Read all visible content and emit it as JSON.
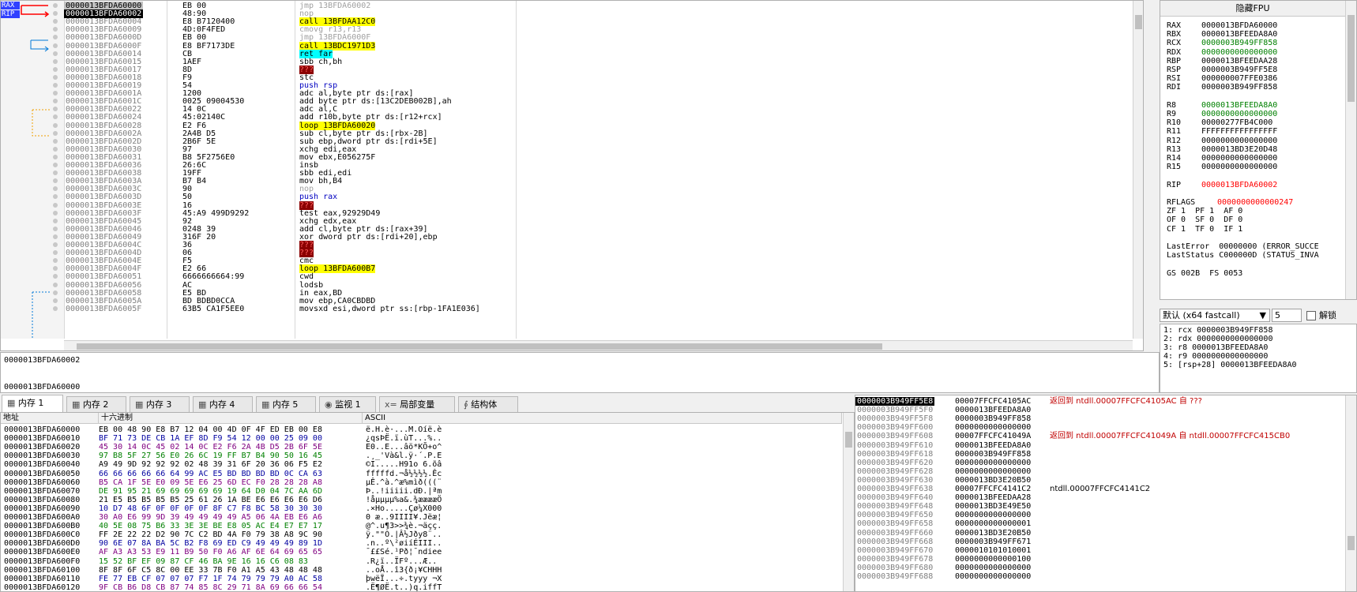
{
  "cpu": {
    "eip_marker": "RAX",
    "rip_marker": "RIP",
    "rows": [
      {
        "addr": "0000013BFDA60000",
        "bytes": "EB 00",
        "asm": "jmp 13BFDA60002",
        "style": "gray",
        "sel": "current"
      },
      {
        "addr": "0000013BFDA60002",
        "bytes": "48:90",
        "asm": "nop",
        "style": "gray",
        "sel": "selected"
      },
      {
        "addr": "0000013BFDA60004",
        "bytes": "E8 B7120400",
        "asm": "call 13BFDAA12C0",
        "style": "call"
      },
      {
        "addr": "0000013BFDA60009",
        "bytes": "4D:0F4FED",
        "asm": "cmovg r13,r13",
        "style": "gray"
      },
      {
        "addr": "0000013BFDA6000D",
        "bytes": "EB 00",
        "asm": "jmp 13BFDA6000F",
        "style": "gray"
      },
      {
        "addr": "0000013BFDA6000F",
        "bytes": "E8 BF7173DE",
        "asm": "call 13BDC1971D3",
        "style": "call"
      },
      {
        "addr": "0000013BFDA60014",
        "bytes": "CB",
        "asm": "ret far",
        "style": "ret"
      },
      {
        "addr": "0000013BFDA60015",
        "bytes": "1AEF",
        "asm": "sbb ch,bh",
        "style": "plain"
      },
      {
        "addr": "0000013BFDA60017",
        "bytes": "8D",
        "asm": "???",
        "style": "bad"
      },
      {
        "addr": "0000013BFDA60018",
        "bytes": "F9",
        "asm": "stc",
        "style": "plain"
      },
      {
        "addr": "0000013BFDA60019",
        "bytes": "54",
        "asm": "push rsp",
        "style": "push"
      },
      {
        "addr": "0000013BFDA6001A",
        "bytes": "1200",
        "asm": "adc al,byte ptr ds:[rax]",
        "style": "plain"
      },
      {
        "addr": "0000013BFDA6001C",
        "bytes": "0025 09004530",
        "asm": "add byte ptr ds:[13C2DEB002B],ah",
        "style": "plain"
      },
      {
        "addr": "0000013BFDA60022",
        "bytes": "14 0C",
        "asm": "adc al,C",
        "style": "plain"
      },
      {
        "addr": "0000013BFDA60024",
        "bytes": "45:02140C",
        "asm": "add r10b,byte ptr ds:[r12+rcx]",
        "style": "plain"
      },
      {
        "addr": "0000013BFDA60028",
        "bytes": "E2 F6",
        "asm": "loop 13BFDA60020",
        "style": "call"
      },
      {
        "addr": "0000013BFDA6002A",
        "bytes": "2A4B D5",
        "asm": "sub cl,byte ptr ds:[rbx-2B]",
        "style": "plain"
      },
      {
        "addr": "0000013BFDA6002D",
        "bytes": "2B6F 5E",
        "asm": "sub ebp,dword ptr ds:[rdi+5E]",
        "style": "plain"
      },
      {
        "addr": "0000013BFDA60030",
        "bytes": "97",
        "asm": "xchg edi,eax",
        "style": "plain"
      },
      {
        "addr": "0000013BFDA60031",
        "bytes": "B8 5F2756E0",
        "asm": "mov ebx,E056275F",
        "style": "plain"
      },
      {
        "addr": "0000013BFDA60036",
        "bytes": "26:6C",
        "asm": "insb",
        "style": "plain"
      },
      {
        "addr": "0000013BFDA60038",
        "bytes": "19FF",
        "asm": "sbb edi,edi",
        "style": "plain"
      },
      {
        "addr": "0000013BFDA6003A",
        "bytes": "B7 B4",
        "asm": "mov bh,B4",
        "style": "plain"
      },
      {
        "addr": "0000013BFDA6003C",
        "bytes": "90",
        "asm": "nop",
        "style": "gray"
      },
      {
        "addr": "0000013BFDA6003D",
        "bytes": "50",
        "asm": "push rax",
        "style": "push"
      },
      {
        "addr": "0000013BFDA6003E",
        "bytes": "16",
        "asm": "???",
        "style": "bad"
      },
      {
        "addr": "0000013BFDA6003F",
        "bytes": "45:A9 499D9292",
        "asm": "test eax,92929D49",
        "style": "plain"
      },
      {
        "addr": "0000013BFDA60045",
        "bytes": "92",
        "asm": "xchg edx,eax",
        "style": "plain"
      },
      {
        "addr": "0000013BFDA60046",
        "bytes": "0248 39",
        "asm": "add cl,byte ptr ds:[rax+39]",
        "style": "plain"
      },
      {
        "addr": "0000013BFDA60049",
        "bytes": "316F 20",
        "asm": "xor dword ptr ds:[rdi+20],ebp",
        "style": "plain"
      },
      {
        "addr": "0000013BFDA6004C",
        "bytes": "36",
        "asm": "???",
        "style": "bad"
      },
      {
        "addr": "0000013BFDA6004D",
        "bytes": "06",
        "asm": "???",
        "style": "bad"
      },
      {
        "addr": "0000013BFDA6004E",
        "bytes": "F5",
        "asm": "cmc",
        "style": "plain"
      },
      {
        "addr": "0000013BFDA6004F",
        "bytes": "E2 66",
        "asm": "loop 13BFDA600B7",
        "style": "call"
      },
      {
        "addr": "0000013BFDA60051",
        "bytes": "6666666664:99",
        "asm": "cwd",
        "style": "plain"
      },
      {
        "addr": "0000013BFDA60056",
        "bytes": "AC",
        "asm": "lodsb",
        "style": "plain"
      },
      {
        "addr": "0000013BFDA60058",
        "bytes": "E5 BD",
        "asm": "in eax,BD",
        "style": "plain"
      },
      {
        "addr": "0000013BFDA6005A",
        "bytes": "BD BDBD0CCA",
        "asm": "mov ebp,CA0CBDBD",
        "style": "plain"
      },
      {
        "addr": "0000013BFDA6005F",
        "bytes": "63B5 CA1F5EE0",
        "asm": "movsxd esi,dword ptr ss:[rbp-1FA1E036]",
        "style": "plain"
      }
    ]
  },
  "info": {
    "line1": "0000013BFDA60002",
    "line2": "0000013BFDA60000"
  },
  "regs": {
    "fpu_button": "隐藏FPU",
    "gp": [
      {
        "n": "RAX",
        "v": "0000013BFDA60000",
        "c": "#000000"
      },
      {
        "n": "RBX",
        "v": "0000013BFEEDA8A0",
        "c": "#000000"
      },
      {
        "n": "RCX",
        "v": "0000003B949FF858",
        "c": "#008000"
      },
      {
        "n": "RDX",
        "v": "0000000000000000",
        "c": "#008000"
      },
      {
        "n": "RBP",
        "v": "0000013BFEEDAA28",
        "c": "#000000"
      },
      {
        "n": "RSP",
        "v": "0000003B949FF5E8",
        "c": "#000000"
      },
      {
        "n": "RSI",
        "v": "000000007FFE0386",
        "c": "#000000"
      },
      {
        "n": "RDI",
        "v": "0000003B949FF858",
        "c": "#000000"
      }
    ],
    "ext": [
      {
        "n": "R8",
        "v": "0000013BFEEDA8A0",
        "c": "#008000"
      },
      {
        "n": "R9",
        "v": "0000000000000000",
        "c": "#008000"
      },
      {
        "n": "R10",
        "v": "00000277FB4C000",
        "c": "#000000"
      },
      {
        "n": "R11",
        "v": "FFFFFFFFFFFFFFFF",
        "c": "#000000"
      },
      {
        "n": "R12",
        "v": "0000000000000000",
        "c": "#000000"
      },
      {
        "n": "R13",
        "v": "0000013BD3E20D48",
        "c": "#000000"
      },
      {
        "n": "R14",
        "v": "0000000000000000",
        "c": "#000000"
      },
      {
        "n": "R15",
        "v": "0000000000000000",
        "c": "#000000"
      }
    ],
    "rip": {
      "n": "RIP",
      "v": "0000013BFDA60002"
    },
    "rflags": {
      "n": "RFLAGS",
      "v": "0000000000000247"
    },
    "flags": [
      "ZF 1  PF 1  AF 0",
      "OF 0  SF 0  DF 0",
      "CF 1  TF 0  IF 1"
    ],
    "lasterror": "LastError  00000000 (ERROR_SUCCE",
    "laststatus": "LastStatus C000000D (STATUS_INVA",
    "segs": "GS 002B  FS 0053"
  },
  "conv": {
    "selected": "默认 (x64 fastcall)",
    "count": "5",
    "unlock_label": "解锁"
  },
  "args": [
    "1: rcx 0000003B949FF858",
    "2: rdx 0000000000000000",
    "3: r8 0000013BFEEDA8A0",
    "4: r9 0000000000000000",
    "5: [rsp+28] 0000013BFEEDA8A0"
  ],
  "tabs": [
    {
      "label": "内存 1",
      "icon": "memory-icon"
    },
    {
      "label": "内存 2",
      "icon": "memory-icon"
    },
    {
      "label": "内存 3",
      "icon": "memory-icon"
    },
    {
      "label": "内存 4",
      "icon": "memory-icon"
    },
    {
      "label": "内存 5",
      "icon": "memory-icon"
    },
    {
      "label": "监视 1",
      "icon": "watch-icon"
    },
    {
      "label": "局部变量",
      "icon": "locals-icon"
    },
    {
      "label": "结构体",
      "icon": "struct-icon"
    }
  ],
  "dump": {
    "headers": {
      "addr": "地址",
      "hex": "十六进制",
      "ascii": "ASCII"
    },
    "rows": [
      {
        "a": "0000013BFDA60000",
        "h": "EB 00 48 90 E8 B7 12 04 00 4D 0F 4F ED EB 00 E8",
        "s": "ë.H.è·...M.Oíë.è"
      },
      {
        "a": "0000013BFDA60010",
        "h": "BF 71 73 DE CB 1A EF 8D F9 54 12 00 00 25 09 00",
        "s": "¿qsÞË.ï.ùT...%.."
      },
      {
        "a": "0000013BFDA60020",
        "h": "45 30 14 0C 45 02 14 0C E2 F6 2A 4B D5 2B 6F 5E",
        "s": "E0..E...âö*KÕ+o^"
      },
      {
        "a": "0000013BFDA60030",
        "h": "97 B8 5F 27 56 E0 26 6C 19 FF B7 B4 90 50 16 45",
        "s": ".¸_'Và&l.ÿ·´.P.E"
      },
      {
        "a": "0000013BFDA60040",
        "h": "A9 49 9D 92 92 92 02 48 39 31 6F 20 36 06 F5 E2",
        "s": "©I.....H91o 6.õâ"
      },
      {
        "a": "0000013BFDA60050",
        "h": "66 66 66 66 66 64 99 AC E5 BD BD BD BD 0C CA 63",
        "s": "fffffd.¬å½½½½.Êc"
      },
      {
        "a": "0000013BFDA60060",
        "h": "B5 CA 1F 5E E0 09 5E E6 25 6D EC F0 28 28 28 A8",
        "s": "µÊ.^à.^æ%mìð(((¨"
      },
      {
        "a": "0000013BFDA60070",
        "h": "DE 91 95 21 69 69 69 69 69 19 64 D0 04 7C AA 6D",
        "s": "Þ..!iiiii.dÐ.|ªm"
      },
      {
        "a": "0000013BFDA60080",
        "h": "21 E5 B5 B5 B5 B5 25 61 26 1A BE E6 E6 E6 E6 D6",
        "s": "!åµµµµ%a&.¾ææææÖ"
      },
      {
        "a": "0000013BFDA60090",
        "h": "10 D7 48 6F 0F 0F 0F 0F 8F C7 F8 BC 58 30 30 30",
        "s": ".×Ho.....Çø¼X000"
      },
      {
        "a": "0000013BFDA600A0",
        "h": "30 A0 E6 99 9D 39 49 49 49 49 A5 06 4A EB E6 A6",
        "s": "0 æ..9IIII¥.Jëæ¦"
      },
      {
        "a": "0000013BFDA600B0",
        "h": "40 5E 08 75 B6 33 3E 3E BE E8 05 AC E4 E7 E7 17",
        "s": "@^.u¶3>>¾è.¬äçç."
      },
      {
        "a": "0000013BFDA600C0",
        "h": "FF 2E 22 22 D2 90 7C C2 BD 4A F0 79 38 A8 9C 90",
        "s": "ÿ.\"\"Ò.|Â½Jðy8¨.."
      },
      {
        "a": "0000013BFDA600D0",
        "h": "90 6E 07 8A BA 5C B2 F8 69 ED C9 49 49 49 89 1D",
        "s": ".n..º\\²øiíÉIII.."
      },
      {
        "a": "0000013BFDA600E0",
        "h": "AF A3 A3 53 E9 11 B9 50 F0 A6 AF 6E 64 69 65 65",
        "s": "¯££Sé.¹Pð¦¯ndiee"
      },
      {
        "a": "0000013BFDA600F0",
        "h": "15 52 BF EF 09 87 CF 46 BA 9E 16 16 C6 08 83",
        "s": ".R¿ï..ÏFº...Æ.."
      },
      {
        "a": "0000013BFDA60100",
        "h": "8F 8F 6F C5 8C 00 EE 33 7B F0 A1 A5 43 48 48 48",
        "s": "..oÅ..î3{ð¡¥CHHH"
      },
      {
        "a": "0000013BFDA60110",
        "h": "FE 77 EB CF 07 07 07 F7 1F 74 79 79 79 A0 AC 58",
        "s": "þwëÏ...÷.tyyy ¬X"
      },
      {
        "a": "0000013BFDA60120",
        "h": "9F CB B6 D8 CB 87 74 85 8C 29 71 8A 69 66 66 54",
        "s": ".Ë¶ØË.t..)q.iffT"
      }
    ]
  },
  "stack": {
    "rows": [
      {
        "a": "0000003B949FF5E8",
        "v": "00007FFCFC4105AC",
        "c": "返回到 ntdll.00007FFCFC4105AC 自 ???",
        "col": "#c00000",
        "sel": true
      },
      {
        "a": "0000003B949FF5F0",
        "v": "0000013BFEEDA8A0",
        "c": ""
      },
      {
        "a": "0000003B949FF5F8",
        "v": "0000003B949FF858",
        "c": ""
      },
      {
        "a": "0000003B949FF600",
        "v": "0000000000000000",
        "c": ""
      },
      {
        "a": "0000003B949FF608",
        "v": "00007FFCFC41049A",
        "c": "返回到 ntdll.00007FFCFC41049A 自 ntdll.00007FFCFC415CB0",
        "col": "#c00000"
      },
      {
        "a": "0000003B949FF610",
        "v": "0000013BFEEDA8A0",
        "c": ""
      },
      {
        "a": "0000003B949FF618",
        "v": "0000003B949FF858",
        "c": ""
      },
      {
        "a": "0000003B949FF620",
        "v": "0000000000000000",
        "c": ""
      },
      {
        "a": "0000003B949FF628",
        "v": "0000000000000000",
        "c": ""
      },
      {
        "a": "0000003B949FF630",
        "v": "0000013BD3E20B50",
        "c": ""
      },
      {
        "a": "0000003B949FF638",
        "v": "00007FFCFC4141C2",
        "c": "ntdll.00007FFCFC4141C2",
        "col": "#000000"
      },
      {
        "a": "0000003B949FF640",
        "v": "0000013BFEEDAA28",
        "c": ""
      },
      {
        "a": "0000003B949FF648",
        "v": "0000013BD3E49E50",
        "c": ""
      },
      {
        "a": "0000003B949FF650",
        "v": "0000000000000000",
        "c": ""
      },
      {
        "a": "0000003B949FF658",
        "v": "0000000000000001",
        "c": ""
      },
      {
        "a": "0000003B949FF660",
        "v": "0000013BD3E20B50",
        "c": ""
      },
      {
        "a": "0000003B949FF668",
        "v": "0000003B949FF671",
        "c": ""
      },
      {
        "a": "0000003B949FF670",
        "v": "0000010101010001",
        "c": ""
      },
      {
        "a": "0000003B949FF678",
        "v": "0000000000000100",
        "c": ""
      },
      {
        "a": "0000003B949FF680",
        "v": "0000000000000000",
        "c": ""
      },
      {
        "a": "0000003B949FF688",
        "v": "0000000000000000",
        "c": ""
      }
    ]
  },
  "colors": {
    "call_bg": "#ffff00",
    "ret_bg": "#00ffff",
    "bad_bg": "#8b0000",
    "selection": "#000000",
    "changed": "#ff0000"
  }
}
